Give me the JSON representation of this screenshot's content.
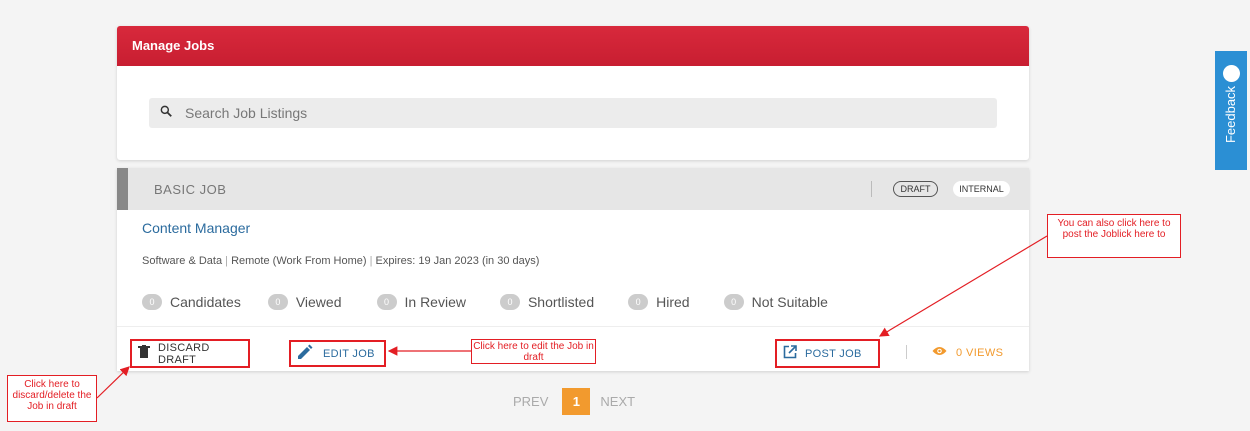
{
  "header": {
    "title": "Manage Jobs"
  },
  "search": {
    "placeholder": "Search Job Listings",
    "icon": "search-icon"
  },
  "job": {
    "type_label": "BASIC JOB",
    "badges": {
      "draft": "DRAFT",
      "internal": "INTERNAL"
    },
    "title": "Content Manager",
    "meta": {
      "category": "Software & Data",
      "location": "Remote (Work From Home)",
      "expires": "Expires: 19 Jan 2023 (in 30 days)"
    },
    "stats": [
      {
        "count": "0",
        "label": "Candidates"
      },
      {
        "count": "0",
        "label": "Viewed"
      },
      {
        "count": "0",
        "label": "In Review"
      },
      {
        "count": "0",
        "label": "Shortlisted"
      },
      {
        "count": "0",
        "label": "Hired"
      },
      {
        "count": "0",
        "label": "Not Suitable"
      }
    ],
    "actions": {
      "discard": "DISCARD DRAFT",
      "edit": "EDIT JOB",
      "post": "POST JOB",
      "views": "0 VIEWS"
    }
  },
  "pagination": {
    "prev": "PREV",
    "current": "1",
    "next": "NEXT"
  },
  "feedback": {
    "label": "Feedback"
  },
  "annotations": {
    "discard": "Click here to discard/delete the Job in draft",
    "edit": "Click here to edit the Job in draft",
    "post": "You can also click here to post the Joblick here to"
  },
  "colors": {
    "header_red": "#d8293c",
    "accent_orange": "#f29a2e",
    "link_blue": "#2b6b9e",
    "feedback_blue": "#2b8fd4",
    "annotation_red": "#e31e24"
  }
}
